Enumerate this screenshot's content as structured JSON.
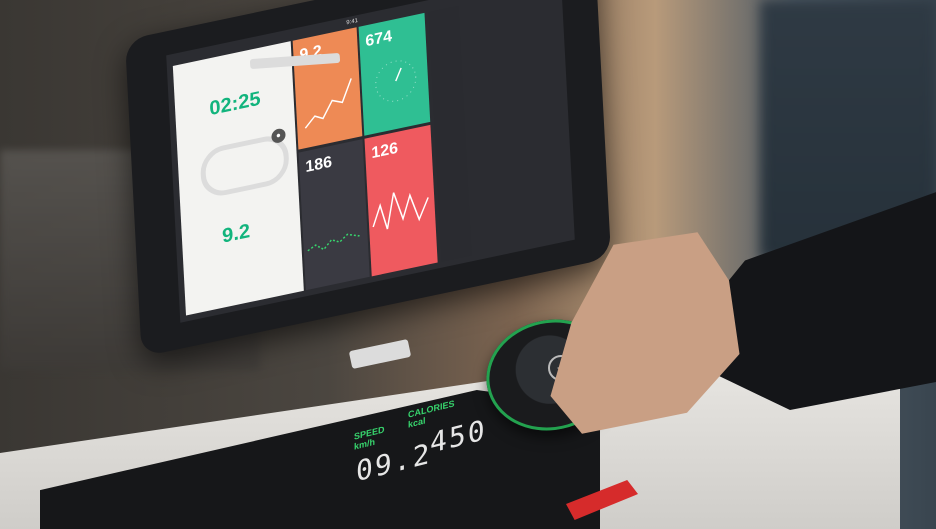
{
  "tablet": {
    "status_time": "9:41",
    "tiles": {
      "timer": {
        "value": "02:25"
      },
      "speed_big": {
        "value": "9.2"
      },
      "orange": {
        "value": "9.2"
      },
      "green": {
        "value": "674"
      },
      "dark": {
        "value": "186"
      },
      "red": {
        "value": "126"
      }
    },
    "track_icon": "run-person-icon",
    "finish_icon": "checkered-flag-icon"
  },
  "console": {
    "speed_label": "SPEED\nkm/h",
    "speed_value": "09.2",
    "calories_label": "CALORIES\nkcal",
    "calories_value": "450"
  },
  "knob": {
    "icon": "plus-minus-icon",
    "accent": "#23a24f"
  },
  "colors": {
    "orange_tile": "#ee8a55",
    "green_tile": "#2fbf93",
    "dark_tile": "#3a3a42",
    "red_tile": "#ef5a5f",
    "display_green": "#37d46d",
    "handle_red": "#d62b2b"
  }
}
